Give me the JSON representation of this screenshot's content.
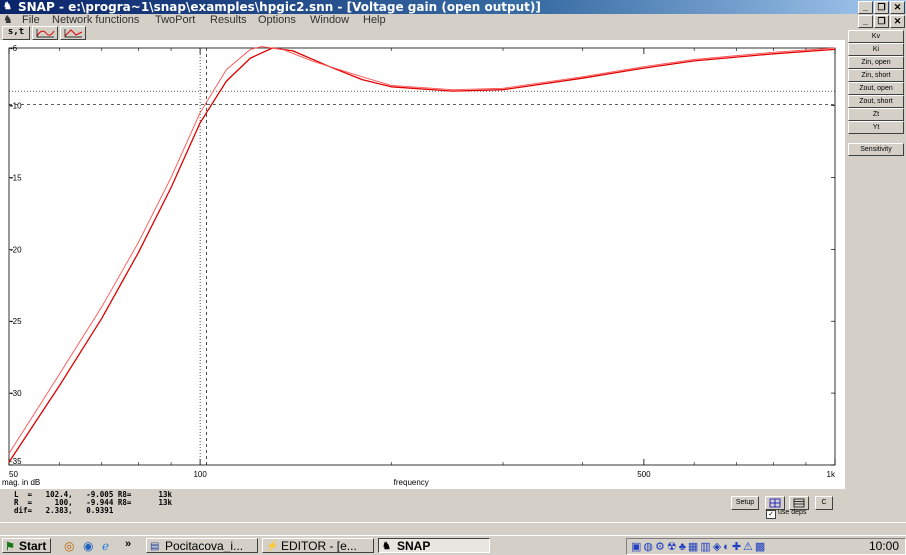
{
  "window": {
    "title": "SNAP - e:\\progra~1\\snap\\examples\\hpgic2.snn - [Voltage gain (open output)]",
    "controls": [
      "_",
      "̅□",
      "X"
    ]
  },
  "menu": [
    "File",
    "Network functions",
    "TwoPort",
    "Results",
    "Options",
    "Window",
    "Help"
  ],
  "toolbar": {
    "st_label": "s,t"
  },
  "right_panel": [
    "Kv",
    "Ki",
    "Zin, open",
    "Zin, short",
    "Zout, open",
    "Zout, short",
    "Zt",
    "Yt",
    "Sensitivity"
  ],
  "chart_data": {
    "type": "line",
    "xscale": "log",
    "xlim": [
      50,
      1000
    ],
    "ylim": [
      -35,
      -6
    ],
    "y_ticks": [
      -6,
      -10,
      -15,
      -20,
      -25,
      -30,
      -35
    ],
    "x_ticks": [
      {
        "value": 50,
        "label": "50"
      },
      {
        "value": 100,
        "label": "100"
      },
      {
        "value": 500,
        "label": "500"
      },
      {
        "value": 1000,
        "label": "1k"
      }
    ],
    "x_minor": [
      60,
      70,
      80,
      90,
      200,
      300,
      400,
      600,
      700,
      800,
      900
    ],
    "xlabel": "frequency",
    "ylabel": "mag. in dB",
    "cursors": {
      "L": 102.4,
      "R": 100
    },
    "h_markers": [
      -9.005,
      -9.944
    ],
    "series": [
      {
        "values": [
          [
            50,
            -34.8
          ],
          [
            60,
            -29.5
          ],
          [
            70,
            -24.8
          ],
          [
            80,
            -20.2
          ],
          [
            90,
            -15.7
          ],
          [
            100,
            -11.2
          ],
          [
            110,
            -8.3
          ],
          [
            120,
            -6.7
          ],
          [
            130,
            -6.0
          ],
          [
            140,
            -6.2
          ],
          [
            160,
            -7.3
          ],
          [
            180,
            -8.2
          ],
          [
            200,
            -8.7
          ],
          [
            250,
            -9.0
          ],
          [
            300,
            -8.9
          ],
          [
            400,
            -8.1
          ],
          [
            500,
            -7.4
          ],
          [
            600,
            -6.9
          ],
          [
            800,
            -6.4
          ],
          [
            1000,
            -6.1
          ]
        ],
        "color": "#e00000",
        "width": 1.3
      },
      {
        "values": [
          [
            50,
            -34.2
          ],
          [
            60,
            -28.7
          ],
          [
            70,
            -24.0
          ],
          [
            80,
            -19.5
          ],
          [
            90,
            -15.0
          ],
          [
            100,
            -10.5
          ],
          [
            110,
            -7.5
          ],
          [
            120,
            -6.1
          ],
          [
            125,
            -5.9
          ],
          [
            135,
            -6.1
          ],
          [
            150,
            -6.9
          ],
          [
            180,
            -8.0
          ],
          [
            200,
            -8.6
          ],
          [
            250,
            -8.9
          ],
          [
            300,
            -8.8
          ],
          [
            400,
            -8.0
          ],
          [
            500,
            -7.3
          ],
          [
            600,
            -6.8
          ],
          [
            800,
            -6.3
          ],
          [
            1000,
            -6.0
          ]
        ],
        "color": "#ff5050",
        "width": 0.9
      }
    ]
  },
  "readout": {
    "line1": "L  =   102.4,   -9.005 R8=      13k",
    "line2": "R  =     100,   -9.944 R8=      13k",
    "line3": "dif=   2.383,   0.9391"
  },
  "bottom_buttons": {
    "setup": "Setup",
    "c": "C",
    "use_deps": "use deps"
  },
  "taskbar": {
    "start": "Start",
    "tasks": [
      "Pocitacova_i...",
      "EDITOR - [e...",
      "SNAP"
    ],
    "clock": "10:00",
    "chevron": "»"
  }
}
